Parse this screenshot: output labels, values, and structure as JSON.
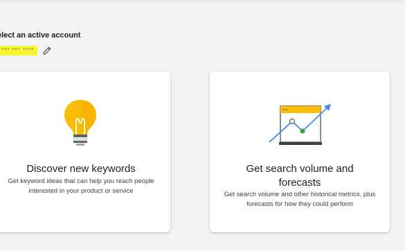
{
  "account": {
    "heading": "elect an active account",
    "id_masked": "*** *** ****"
  },
  "cards": [
    {
      "title": "Discover new keywords",
      "description": "Get keyword ideas that can help you reach people interested in your product or service",
      "icon": "lightbulb-icon"
    },
    {
      "title": "Get search volume and forecasts",
      "description": "Get search volume and other historical metrics, plus forecasts for how they could perform",
      "icon": "forecast-chart-icon"
    }
  ],
  "colors": {
    "background": "#f1f3f4",
    "highlight": "#f5f532",
    "bulb": "#fbbc04",
    "chart_line": "#4285f4",
    "chart_dot": "#34a853"
  }
}
